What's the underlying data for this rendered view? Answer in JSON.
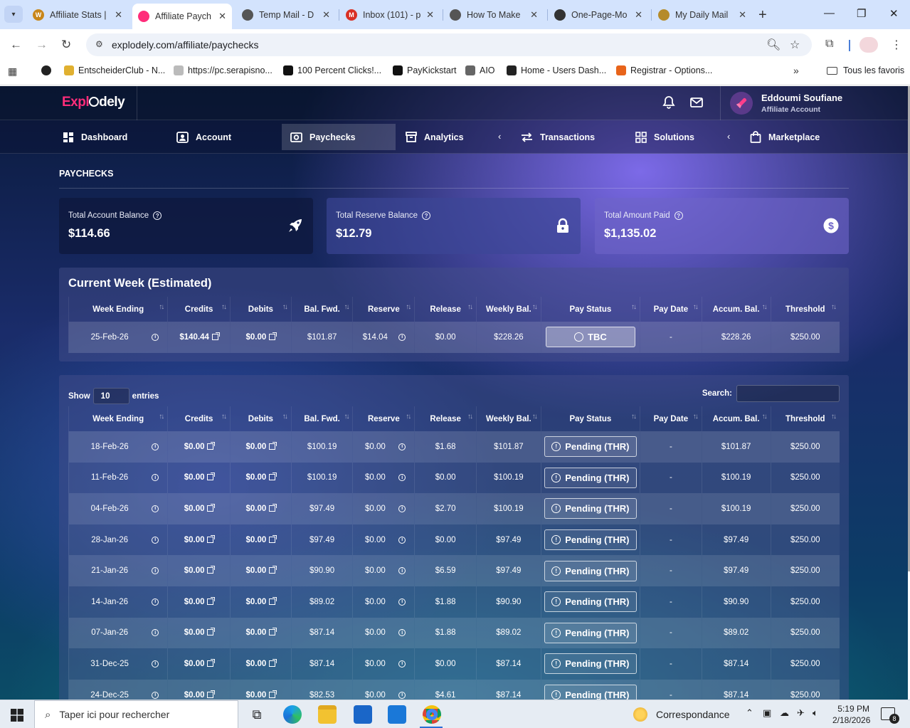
{
  "browser": {
    "tabs": [
      {
        "title": "Affiliate Stats |",
        "fav_color": "#c8861a",
        "fav_glyph": "W"
      },
      {
        "title": "Affiliate Paych",
        "fav_color": "#ff2d7a",
        "fav_glyph": "",
        "active": true
      },
      {
        "title": "Temp Mail - D",
        "fav_color": "#555555",
        "fav_glyph": ""
      },
      {
        "title": "Inbox (101) - p",
        "fav_color": "#d93025",
        "fav_glyph": "M"
      },
      {
        "title": "How To Make",
        "fav_color": "#555555",
        "fav_glyph": ""
      },
      {
        "title": "One-Page-Mo",
        "fav_color": "#333333",
        "fav_glyph": ""
      },
      {
        "title": "My Daily Mail",
        "fav_color": "#b58b2a",
        "fav_glyph": ""
      }
    ],
    "url": "explodely.com/affiliate/paychecks",
    "bookmarks": [
      {
        "label": "",
        "color": "#222222"
      },
      {
        "label": "EntscheiderClub - N...",
        "color": "#e0b030"
      },
      {
        "label": "https://pc.serapisno...",
        "color": "#bbbbbb"
      },
      {
        "label": "100 Percent Clicks!...",
        "color": "#111111"
      },
      {
        "label": "PayKickstart",
        "color": "#111111"
      },
      {
        "label": "AIO",
        "color": "#666666"
      },
      {
        "label": "Home - Users Dash...",
        "color": "#222222"
      },
      {
        "label": "Registrar - Options...",
        "color": "#e8641a"
      }
    ],
    "all_bookmarks": "Tous les favoris"
  },
  "app": {
    "logo_a": "Expl",
    "logo_b": "dely",
    "user_name": "Eddoumi Soufiane",
    "user_role": "Affiliate Account",
    "menu": {
      "dashboard": "Dashboard",
      "account": "Account",
      "paychecks": "Paychecks",
      "analytics": "Analytics",
      "transactions": "Transactions",
      "solutions": "Solutions",
      "marketplace": "Marketplace"
    },
    "page_title": "PAYCHECKS",
    "cards": [
      {
        "label": "Total Account Balance",
        "value": "$114.66",
        "icon": "rocket-icon"
      },
      {
        "label": "Total Reserve Balance",
        "value": "$12.79",
        "icon": "lock-icon"
      },
      {
        "label": "Total Amount Paid",
        "value": "$1,135.02",
        "icon": "dollar-icon"
      }
    ],
    "current_week_title": "Current Week (Estimated)",
    "columns": [
      "Week Ending",
      "Credits",
      "Debits",
      "Bal. Fwd.",
      "Reserve",
      "Release",
      "Weekly Bal.",
      "Pay Status",
      "Pay Date",
      "Accum. Bal.",
      "Threshold"
    ],
    "current_week": {
      "week": "25-Feb-26",
      "credits": "$140.44",
      "debits": "$0.00",
      "bal_fwd": "$101.87",
      "reserve": "$14.04",
      "release": "$0.00",
      "weekly_bal": "$228.26",
      "status": "TBC",
      "pay_date": "-",
      "accum": "$228.26",
      "threshold": "$250.00"
    },
    "show_label": "Show",
    "entries_value": "10",
    "entries_label": "entries",
    "search_label": "Search:",
    "history": [
      {
        "week": "18-Feb-26",
        "credits": "$0.00",
        "debits": "$0.00",
        "bal_fwd": "$100.19",
        "reserve": "$0.00",
        "release": "$1.68",
        "weekly_bal": "$101.87",
        "status": "Pending (THR)",
        "pay_date": "-",
        "accum": "$101.87",
        "threshold": "$250.00"
      },
      {
        "week": "11-Feb-26",
        "credits": "$0.00",
        "debits": "$0.00",
        "bal_fwd": "$100.19",
        "reserve": "$0.00",
        "release": "$0.00",
        "weekly_bal": "$100.19",
        "status": "Pending (THR)",
        "pay_date": "-",
        "accum": "$100.19",
        "threshold": "$250.00"
      },
      {
        "week": "04-Feb-26",
        "credits": "$0.00",
        "debits": "$0.00",
        "bal_fwd": "$97.49",
        "reserve": "$0.00",
        "release": "$2.70",
        "weekly_bal": "$100.19",
        "status": "Pending (THR)",
        "pay_date": "-",
        "accum": "$100.19",
        "threshold": "$250.00"
      },
      {
        "week": "28-Jan-26",
        "credits": "$0.00",
        "debits": "$0.00",
        "bal_fwd": "$97.49",
        "reserve": "$0.00",
        "release": "$0.00",
        "weekly_bal": "$97.49",
        "status": "Pending (THR)",
        "pay_date": "-",
        "accum": "$97.49",
        "threshold": "$250.00"
      },
      {
        "week": "21-Jan-26",
        "credits": "$0.00",
        "debits": "$0.00",
        "bal_fwd": "$90.90",
        "reserve": "$0.00",
        "release": "$6.59",
        "weekly_bal": "$97.49",
        "status": "Pending (THR)",
        "pay_date": "-",
        "accum": "$97.49",
        "threshold": "$250.00"
      },
      {
        "week": "14-Jan-26",
        "credits": "$0.00",
        "debits": "$0.00",
        "bal_fwd": "$89.02",
        "reserve": "$0.00",
        "release": "$1.88",
        "weekly_bal": "$90.90",
        "status": "Pending (THR)",
        "pay_date": "-",
        "accum": "$90.90",
        "threshold": "$250.00"
      },
      {
        "week": "07-Jan-26",
        "credits": "$0.00",
        "debits": "$0.00",
        "bal_fwd": "$87.14",
        "reserve": "$0.00",
        "release": "$1.88",
        "weekly_bal": "$89.02",
        "status": "Pending (THR)",
        "pay_date": "-",
        "accum": "$89.02",
        "threshold": "$250.00"
      },
      {
        "week": "31-Dec-25",
        "credits": "$0.00",
        "debits": "$0.00",
        "bal_fwd": "$87.14",
        "reserve": "$0.00",
        "release": "$0.00",
        "weekly_bal": "$87.14",
        "status": "Pending (THR)",
        "pay_date": "-",
        "accum": "$87.14",
        "threshold": "$250.00"
      },
      {
        "week": "24-Dec-25",
        "credits": "$0.00",
        "debits": "$0.00",
        "bal_fwd": "$82.53",
        "reserve": "$0.00",
        "release": "$4.61",
        "weekly_bal": "$87.14",
        "status": "Pending (THR)",
        "pay_date": "-",
        "accum": "$87.14",
        "threshold": "$250.00"
      }
    ]
  },
  "taskbar": {
    "search_placeholder": "Taper ici pour rechercher",
    "weather": "Correspondance",
    "time": "5:19 PM",
    "date": "2/18/2026",
    "notifications": "8"
  }
}
